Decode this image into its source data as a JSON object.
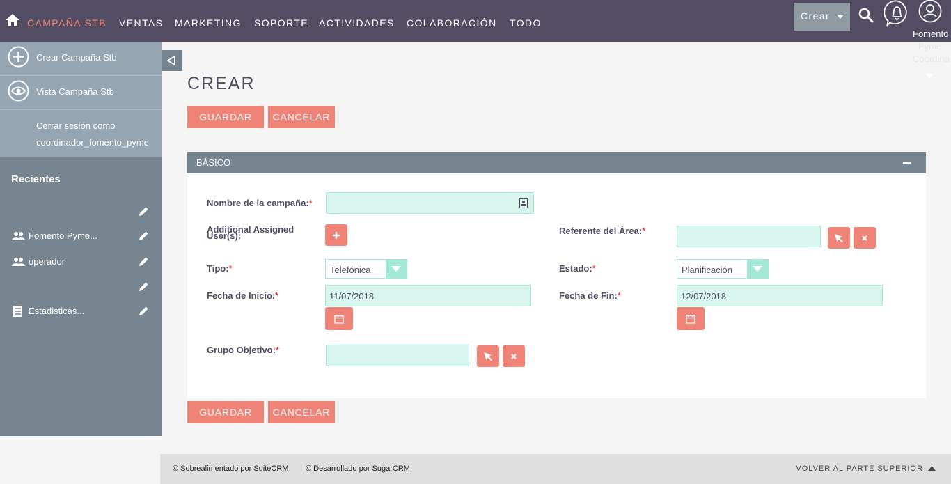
{
  "nav": {
    "items": [
      "Campaña Stb",
      "Ventas",
      "Marketing",
      "Soporte",
      "Actividades",
      "Colaboración",
      "Todo"
    ],
    "create_label": "Crear",
    "user_name": "Fomento",
    "user_overflow_1": "Pyme",
    "user_overflow_2": "Coordina"
  },
  "sidebar": {
    "actions": [
      "Crear Campaña Stb",
      "Vista Campaña Stb"
    ],
    "logout_line1": "Cerrar sesión como",
    "logout_line2": "coordinador_fomento_pyme",
    "recent_title": "Recientes",
    "recent_items": [
      {
        "label": "",
        "icon": "none"
      },
      {
        "label": "Fomento Pyme...",
        "icon": "users-icon"
      },
      {
        "label": "operador",
        "icon": "users-icon"
      },
      {
        "label": "",
        "icon": "none"
      },
      {
        "label": "Estadisticas...",
        "icon": "document-icon"
      }
    ]
  },
  "page": {
    "title": "CREAR",
    "save_label": "Guardar",
    "cancel_label": "Cancelar"
  },
  "panel": {
    "title": "BÁSICO",
    "fields": {
      "campaign_name": {
        "label": "Nombre de la campaña:",
        "value": ""
      },
      "additional_users": {
        "label": "Additional Assigned User(s):"
      },
      "area_ref": {
        "label": "Referente del Área:",
        "value": ""
      },
      "type": {
        "label": "Tipo:",
        "value": "Telefónica"
      },
      "status": {
        "label": "Estado:",
        "value": "Planificación"
      },
      "start_date": {
        "label": "Fecha de Inicio:",
        "value": "11/07/2018"
      },
      "end_date": {
        "label": "Fecha de Fin:",
        "value": "12/07/2018"
      },
      "target_group": {
        "label": "Grupo Objetivo:",
        "value": ""
      }
    },
    "required_marker": "*"
  },
  "footer": {
    "suitecrm": "© Sobrealimentado por SuiteCRM",
    "sugarcrm": "© Desarrollado por SugarCRM",
    "back_to_top": "Volver al parte superior"
  },
  "colors": {
    "nav_bg": "#534d64",
    "accent": "#f08377",
    "sidebar_bg": "#778591",
    "sidebar_action_bg": "#95a5b1",
    "input_bg": "#d8f5ee",
    "input_border": "#a5e8d6"
  }
}
